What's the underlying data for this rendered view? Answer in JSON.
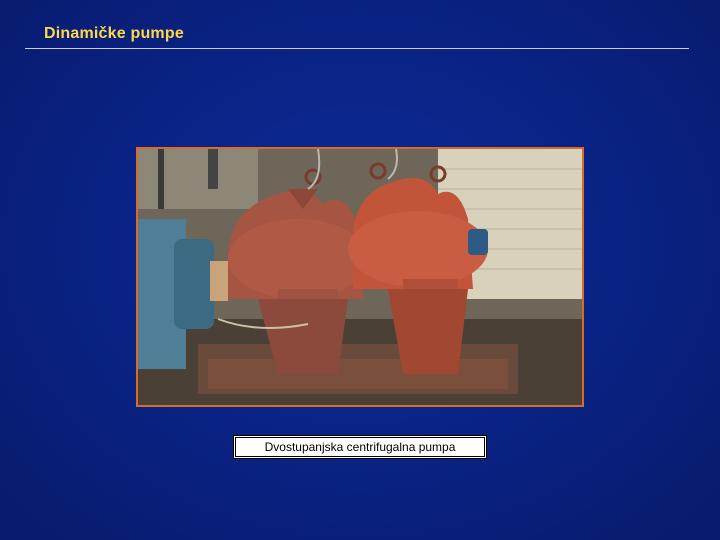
{
  "slide": {
    "title": "Dinamičke pumpe",
    "caption": "Dvostupanjska centrifugalna pumpa"
  },
  "colors": {
    "background": "#0a2386",
    "title": "#ffd84a",
    "frame_border": "#d86a2a"
  }
}
